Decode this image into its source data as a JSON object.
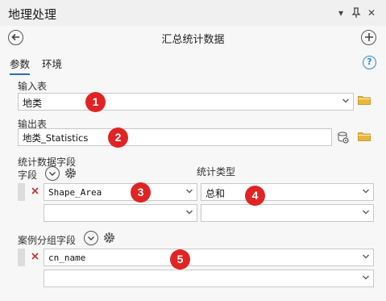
{
  "pane": {
    "title": "地理处理",
    "menu_glyph": "▾",
    "pin_glyph": "ꟷ",
    "close_glyph": "✕"
  },
  "tool": {
    "title": "汇总统计数据",
    "back_glyph": "←",
    "add_glyph": "+"
  },
  "tabs": {
    "params": "参数",
    "env": "环境",
    "help_glyph": "?"
  },
  "input_table": {
    "label": "输入表",
    "value": "地类"
  },
  "output_table": {
    "label": "输出表",
    "value": "地类_Statistics"
  },
  "stat_fields": {
    "label": "统计数据字段",
    "field_label": "字段",
    "stat_type_label": "统计类型",
    "rows": [
      {
        "field": "Shape_Area",
        "stat": "总和"
      },
      {
        "field": "",
        "stat": ""
      }
    ]
  },
  "case_fields": {
    "label": "案例分组字段",
    "rows": [
      {
        "field": "cn_name"
      },
      {
        "field": ""
      }
    ]
  },
  "badges": [
    "1",
    "2",
    "3",
    "4",
    "5"
  ],
  "colors": {
    "accent": "#2a6ebb",
    "badge": "#e02424",
    "remove": "#c8312b",
    "folder": "#e8b73a"
  },
  "icons": {
    "folder": "folder-icon",
    "gear": "gear-icon",
    "chevron": "chevron-down-icon",
    "remove": "remove-x-icon"
  }
}
